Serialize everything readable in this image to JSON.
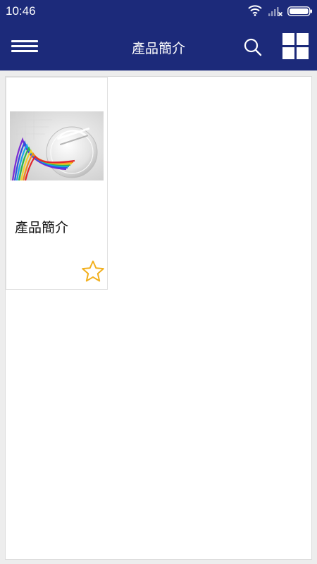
{
  "status_bar": {
    "time": "10:46",
    "icons": [
      "wifi-icon",
      "signal-icon",
      "battery-icon"
    ]
  },
  "app_bar": {
    "title": "產品簡介",
    "icons": [
      "menu-icon",
      "search-icon",
      "grid-view-icon"
    ],
    "color": "#1c2a7a"
  },
  "items": [
    {
      "title": "產品簡介",
      "thumbnail": "product-brochure-image",
      "favorite_icon": "star-outline-icon",
      "favorite_color": "#f2b01e"
    }
  ]
}
